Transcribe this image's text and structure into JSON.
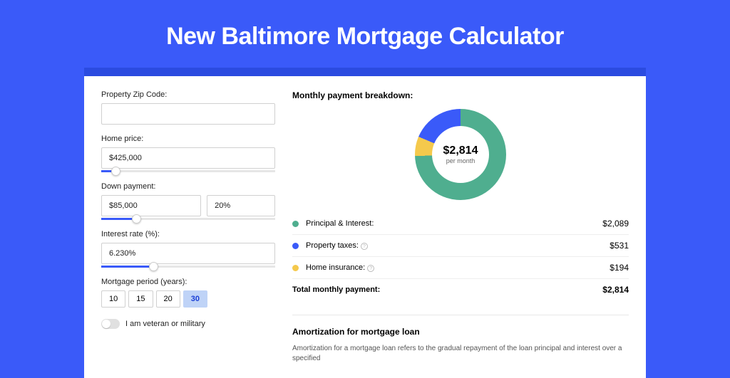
{
  "title": "New Baltimore Mortgage Calculator",
  "left": {
    "zip_label": "Property Zip Code:",
    "zip_value": "",
    "home_price_label": "Home price:",
    "home_price_value": "$425,000",
    "home_price_slider_pct": 8,
    "down_payment_label": "Down payment:",
    "down_payment_value": "$85,000",
    "down_payment_pct_value": "20%",
    "down_payment_slider_pct": 20,
    "interest_label": "Interest rate (%):",
    "interest_value": "6.230%",
    "interest_slider_pct": 30,
    "period_label": "Mortgage period (years):",
    "period_options": [
      "10",
      "15",
      "20",
      "30"
    ],
    "period_selected": "30",
    "veteran_label": "I am veteran or military"
  },
  "right": {
    "breakdown_title": "Monthly payment breakdown:",
    "center_amount": "$2,814",
    "center_sub": "per month",
    "legend": [
      {
        "label": "Principal & Interest:",
        "value": "$2,089",
        "color": "#4fae8f",
        "info": false
      },
      {
        "label": "Property taxes:",
        "value": "$531",
        "color": "#3a5af9",
        "info": true
      },
      {
        "label": "Home insurance:",
        "value": "$194",
        "color": "#f5c94c",
        "info": true
      }
    ],
    "total_label": "Total monthly payment:",
    "total_value": "$2,814",
    "amort_title": "Amortization for mortgage loan",
    "amort_text": "Amortization for a mortgage loan refers to the gradual repayment of the loan principal and interest over a specified"
  },
  "chart_data": {
    "type": "pie",
    "title": "Monthly payment breakdown",
    "series": [
      {
        "name": "Principal & Interest",
        "value": 2089,
        "color": "#4fae8f"
      },
      {
        "name": "Property taxes",
        "value": 531,
        "color": "#3a5af9"
      },
      {
        "name": "Home insurance",
        "value": 194,
        "color": "#f5c94c"
      }
    ],
    "total": 2814,
    "center_label": "$2,814 per month"
  }
}
